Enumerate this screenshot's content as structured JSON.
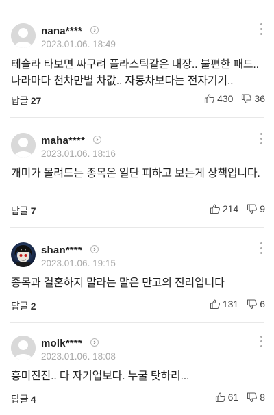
{
  "comments": [
    {
      "username": "nana****",
      "date": "2023.01.06. 18:49",
      "lines": [
        "테슬라 타보면 싸구려 플라스틱같은 내장.. 불편한 패드..",
        "나라마다 천차만별 차값.. 자동차보다는 전자기기.."
      ],
      "reply_label": "답글",
      "reply_count": "27",
      "like_count": "430",
      "dislike_count": "36",
      "avatar": "default"
    },
    {
      "username": "maha****",
      "date": "2023.01.06. 18:16",
      "lines": [
        "개미가 몰려드는 종목은 일단 피하고 보는게 상책입니다."
      ],
      "reply_label": "답글",
      "reply_count": "7",
      "like_count": "214",
      "dislike_count": "9",
      "avatar": "default"
    },
    {
      "username": "shan****",
      "date": "2023.01.06. 19:15",
      "lines": [
        "종목과 결혼하지 말라는 말은 만고의 진리입니다"
      ],
      "reply_label": "답글",
      "reply_count": "2",
      "like_count": "131",
      "dislike_count": "6",
      "avatar": "custom"
    },
    {
      "username": "molk****",
      "date": "2023.01.06. 18:08",
      "lines": [
        "흥미진진.. 다 자기업보다. 누굴 탓하리..."
      ],
      "reply_label": "답글",
      "reply_count": "4",
      "like_count": "61",
      "dislike_count": "8",
      "avatar": "default"
    }
  ],
  "icons": {
    "like": "thumbs-up-outline-icon",
    "dislike": "thumbs-down-outline-icon",
    "more": "vertical-ellipsis-icon",
    "profile": "chevron-right-circle-icon"
  },
  "colors": {
    "divider": "#e8e8e8",
    "date": "#a8a8a8",
    "avatar_placeholder": "#d9d9d9"
  }
}
